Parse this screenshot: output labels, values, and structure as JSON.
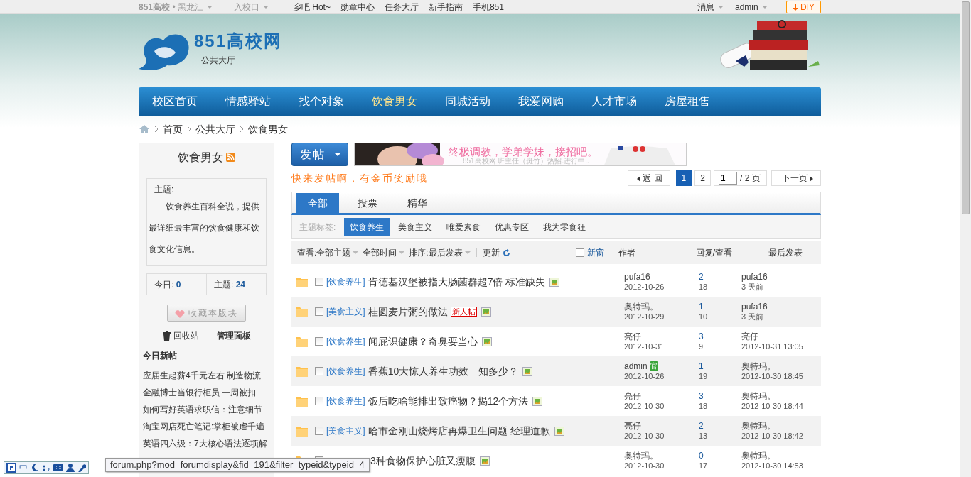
{
  "top_bar": {
    "site": "851高校",
    "region": "• 黑龙江",
    "entry": "入校口",
    "links": [
      "乡吧 Hot~",
      "勋章中心",
      "任务大厅",
      "新手指南",
      "手机851"
    ],
    "messages": "消息",
    "user": "admin",
    "diy": "DIY"
  },
  "header": {
    "logo_title": "851高校网",
    "logo_subtitle": "公共大厅"
  },
  "nav": [
    {
      "label": "校区首页",
      "selected": false
    },
    {
      "label": "情感驿站",
      "selected": false
    },
    {
      "label": "找个对象",
      "selected": false
    },
    {
      "label": "饮食男女",
      "selected": true
    },
    {
      "label": "同城活动",
      "selected": false
    },
    {
      "label": "我爱网购",
      "selected": false
    },
    {
      "label": "人才市场",
      "selected": false
    },
    {
      "label": "房屋租售",
      "selected": false
    }
  ],
  "breadcrumb": [
    "首页",
    "公共大厅",
    "饮食男女"
  ],
  "sidebar": {
    "title": "饮食男女",
    "intro_label": "主题:",
    "intro_text": "饮食养生百科全说，提供最详细最丰富的饮食健康和饮食文化信息。",
    "stats": [
      {
        "label": "今日:",
        "value": "0"
      },
      {
        "label": "主题:",
        "value": "24"
      }
    ],
    "favorite_button": "收藏本版块",
    "recycle": "回收站",
    "manage": "管理面板",
    "new_posts_title": "今日新帖",
    "new_posts": [
      "应届生起薪4千元左右 制造物流",
      "金融博士当银行柜员 一周被扣",
      "如何写好英语求职信：注意细节",
      "淘宝网店死亡笔记:掌柜被虐千遍",
      "英语四六级：7大核心语法逐项解"
    ]
  },
  "post_button": "发帖",
  "banner": {
    "headline": "终极调教，学弟学妹，接招吧。",
    "subline": "851高校网 班主任（斑竹）热招.进行中.."
  },
  "slogan": "快来发帖啊，有金币奖励哦",
  "pagination": {
    "back": "返 回",
    "pages": [
      {
        "label": "1",
        "selected": true
      },
      {
        "label": "2",
        "selected": false
      }
    ],
    "page_input": "1",
    "total": "/ 2 页",
    "next": "下一页"
  },
  "tabs": [
    {
      "label": "全部",
      "selected": true
    },
    {
      "label": "投票",
      "selected": false
    },
    {
      "label": "精华",
      "selected": false
    }
  ],
  "tag_filter": {
    "label": "主题标签:",
    "tags": [
      {
        "label": "饮食养生",
        "selected": true
      },
      {
        "label": "美食主义",
        "selected": false
      },
      {
        "label": "唯爱素食",
        "selected": false
      },
      {
        "label": "优惠专区",
        "selected": false
      },
      {
        "label": "我为零食狂",
        "selected": false
      }
    ]
  },
  "toolbar": {
    "view_label": "查看:",
    "view": "全部主题",
    "time": "全部时间",
    "sort_label": "排序:",
    "sort": "最后发表",
    "refresh": "更新",
    "new_window": {
      "label": "新窗",
      "checked": false
    },
    "columns": [
      "作者",
      "回复/查看",
      "最后发表"
    ]
  },
  "threads": [
    {
      "tag": "[饮食养生]",
      "title": "肯德基汉堡被指大肠菌群超7倍 标准缺失",
      "checked": false,
      "has_image": true,
      "author": "pufa16",
      "date": "2012-10-26",
      "replies": "2",
      "views": "18",
      "last_user": "pufa16",
      "last_time": "3 天前"
    },
    {
      "tag": "[美食主义]",
      "title": "桂圆麦片粥的做法",
      "badge": "新人帖",
      "checked": false,
      "has_image": true,
      "author": "奥特玛。",
      "date": "2012-10-29",
      "replies": "1",
      "views": "10",
      "last_user": "pufa16",
      "last_time": "3 天前"
    },
    {
      "tag": "[饮食养生]",
      "title": "闻屁识健康？奇臭要当心",
      "checked": false,
      "has_image": true,
      "author": "亮仔",
      "date": "2012-10-31",
      "replies": "3",
      "views": "9",
      "last_user": "亮仔",
      "last_time": "2012-10-31 13:05"
    },
    {
      "tag": "[饮食养生]",
      "title": "香蕉10大惊人养生功效　知多少？",
      "checked": false,
      "has_image": true,
      "author": "admin",
      "author_badge": "官",
      "date": "2012-10-26",
      "replies": "1",
      "views": "19",
      "last_user": "奥特玛。",
      "last_time": "2012-10-30 18:45"
    },
    {
      "tag": "[饮食养生]",
      "title": "饭后吃啥能排出致癌物？揭12个方法",
      "checked": false,
      "has_image": true,
      "author": "亮仔",
      "date": "2012-10-30",
      "replies": "3",
      "views": "18",
      "last_user": "奥特玛。",
      "last_time": "2012-10-30 18:44"
    },
    {
      "tag": "[美食主义]",
      "title": "哈市金刚山烧烤店再爆卫生问题 经理道歉",
      "checked": false,
      "has_image": true,
      "author": "亮仔",
      "date": "2012-10-30",
      "replies": "2",
      "views": "13",
      "last_user": "奥特玛。",
      "last_time": "2012-10-30 18:42"
    },
    {
      "title": "3种食物保护心脏又瘦腹",
      "checked": false,
      "has_image": true,
      "author": "奥特玛。",
      "date": "2012-10-30",
      "replies": "0",
      "views": "17",
      "last_user": "奥特玛。",
      "last_time": "2012-10-30 14:53"
    }
  ],
  "status_bar": {
    "url": "forum.php?mod=forumdisplay&fid=191&filter=typeid&typeid=4"
  },
  "ime_toolbar": {
    "mode": "中"
  }
}
